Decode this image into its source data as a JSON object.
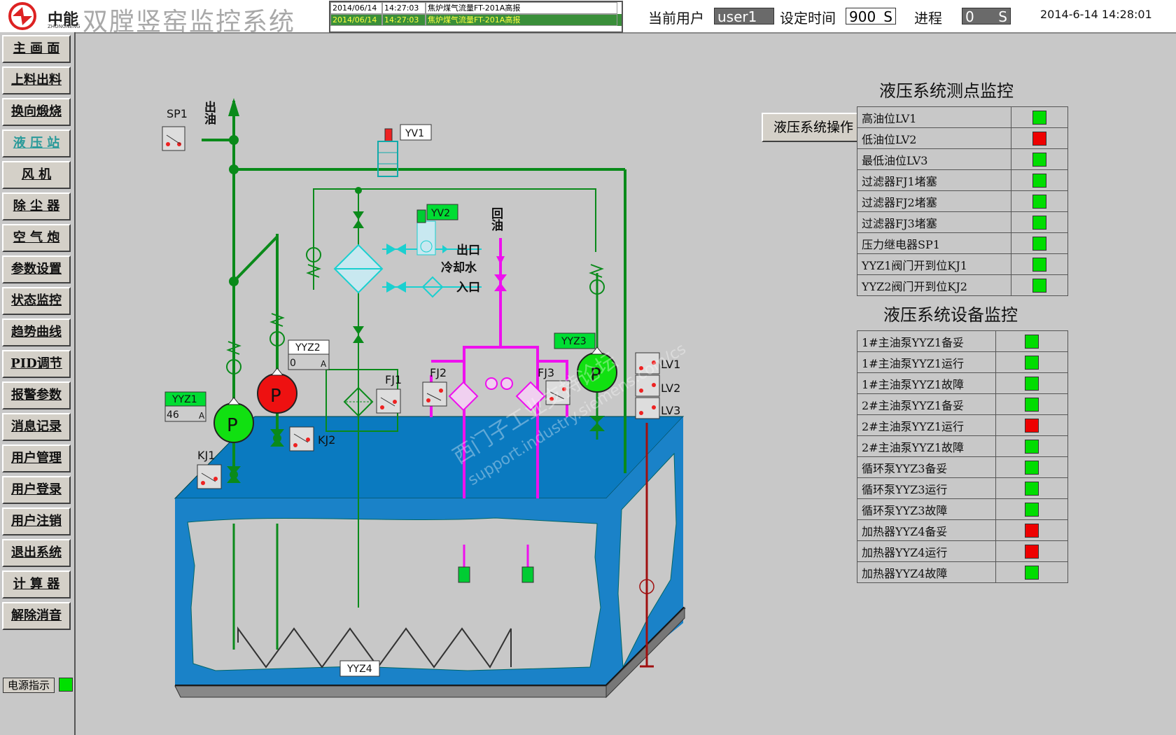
{
  "header": {
    "logo_brand": "中能",
    "logo_sub": "ZHONGNENG",
    "title": "双膛竖窑监控系统",
    "alarms": [
      {
        "date": "2014/06/14",
        "time": "14:27:03",
        "msg": "焦炉煤气流量FT-201A高报"
      },
      {
        "date": "2014/06/14",
        "time": "14:27:03",
        "msg": "焦炉煤气流量FT-201A高报"
      }
    ],
    "current_user_label": "当前用户",
    "current_user": "user1",
    "set_time_label": "设定时间",
    "set_time": "900",
    "set_time_unit": "S",
    "progress_label": "进程",
    "progress": "0",
    "progress_unit": "S",
    "datetime": "2014-6-14 14:28:01"
  },
  "sidebar": {
    "items": [
      {
        "label": "主 画 面"
      },
      {
        "label": "上料出料"
      },
      {
        "label": "换向煅烧"
      },
      {
        "label": "液 压 站"
      },
      {
        "label": "风  机"
      },
      {
        "label": "除 尘 器"
      },
      {
        "label": "空 气 炮"
      },
      {
        "label": "参数设置"
      },
      {
        "label": "状态监控"
      },
      {
        "label": "趋势曲线"
      },
      {
        "label": "PID调节"
      },
      {
        "label": "报警参数"
      },
      {
        "label": "消息记录"
      },
      {
        "label": "用户管理"
      },
      {
        "label": "用户登录"
      },
      {
        "label": "用户注销"
      },
      {
        "label": "退出系统"
      },
      {
        "label": "计 算 器"
      },
      {
        "label": "解除消音"
      }
    ],
    "active_index": 3,
    "power_label": "电源指示"
  },
  "diagram": {
    "sp1": "SP1",
    "oil_out": "出油",
    "yv1": "YV1",
    "yv2": "YV2",
    "return_oil": "回油",
    "outlet": "出口",
    "cooling_water": "冷却水",
    "inlet": "入口",
    "yyz1": "YYZ1",
    "yyz1_value": "46",
    "yyz1_unit": "A",
    "yyz2": "YYZ2",
    "yyz2_value": "0",
    "yyz2_unit": "A",
    "yyz3": "YYZ3",
    "yyz4": "YYZ4",
    "kj1": "KJ1",
    "kj2": "KJ2",
    "fj1": "FJ1",
    "fj2": "FJ2",
    "fj3": "FJ3",
    "lv1": "LV1",
    "lv2": "LV2",
    "lv3": "LV3",
    "pump_letter": "P",
    "watermark": "西门子工业支持论坛",
    "watermark_url": "support.industry.siemens.com/cs"
  },
  "hydraulic_op_button": "液压系统操作",
  "points_panel": {
    "title": "液压系统测点监控",
    "rows": [
      {
        "label": "高油位LV1",
        "status": "#00dd00"
      },
      {
        "label": "低油位LV2",
        "status": "#ee0000"
      },
      {
        "label": "最低油位LV3",
        "status": "#00dd00"
      },
      {
        "label": "过滤器FJ1堵塞",
        "status": "#00dd00"
      },
      {
        "label": "过滤器FJ2堵塞",
        "status": "#00dd00"
      },
      {
        "label": "过滤器FJ3堵塞",
        "status": "#00dd00"
      },
      {
        "label": "压力继电器SP1",
        "status": "#00dd00"
      },
      {
        "label": "YYZ1阀门开到位KJ1",
        "status": "#00dd00"
      },
      {
        "label": "YYZ2阀门开到位KJ2",
        "status": "#00dd00"
      }
    ]
  },
  "devices_panel": {
    "title": "液压系统设备监控",
    "rows": [
      {
        "label": "1#主油泵YYZ1备妥",
        "status": "#00dd00"
      },
      {
        "label": "1#主油泵YYZ1运行",
        "status": "#00dd00"
      },
      {
        "label": "1#主油泵YYZ1故障",
        "status": "#00dd00"
      },
      {
        "label": "2#主油泵YYZ1备妥",
        "status": "#00dd00"
      },
      {
        "label": "2#主油泵YYZ1运行",
        "status": "#ee0000"
      },
      {
        "label": "2#主油泵YYZ1故障",
        "status": "#00dd00"
      },
      {
        "label": "循环泵YYZ3备妥",
        "status": "#00dd00"
      },
      {
        "label": "循环泵YYZ3运行",
        "status": "#00dd00"
      },
      {
        "label": "循环泵YYZ3故障",
        "status": "#00dd00"
      },
      {
        "label": "加热器YYZ4备妥",
        "status": "#ee0000"
      },
      {
        "label": "加热器YYZ4运行",
        "status": "#ee0000"
      },
      {
        "label": "加热器YYZ4故障",
        "status": "#00dd00"
      }
    ]
  }
}
